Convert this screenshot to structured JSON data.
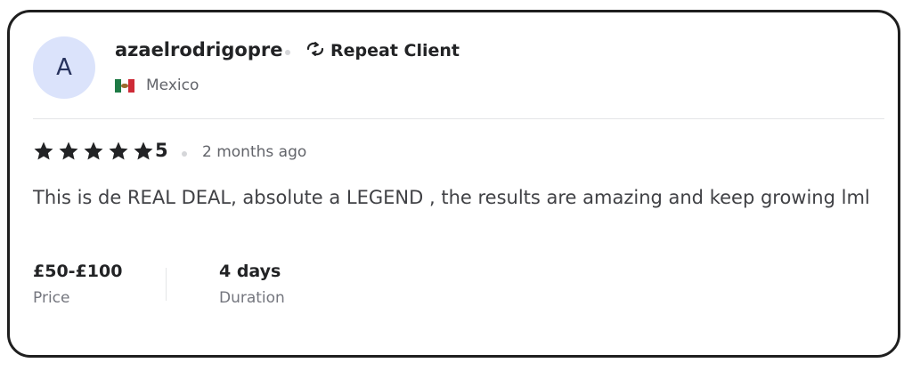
{
  "review": {
    "avatar_letter": "A",
    "username": "azaelrodrigopre",
    "badge": {
      "icon": "repeat-icon",
      "label": "Repeat Client"
    },
    "country": {
      "flag": "mexico-flag-icon",
      "name": "Mexico"
    },
    "rating": {
      "stars": 5,
      "value": "5"
    },
    "time_ago": "2 months ago",
    "text": "This is de REAL DEAL, absolute a LEGEND , the results are amazing and keep growing lml",
    "price": {
      "value": "£50-£100",
      "label": "Price"
    },
    "duration": {
      "value": "4 days",
      "label": "Duration"
    }
  },
  "colors": {
    "avatar_bg": "#dbe3fb",
    "text_primary": "#222325",
    "text_muted": "#62646a",
    "border": "#1f1f1f"
  }
}
